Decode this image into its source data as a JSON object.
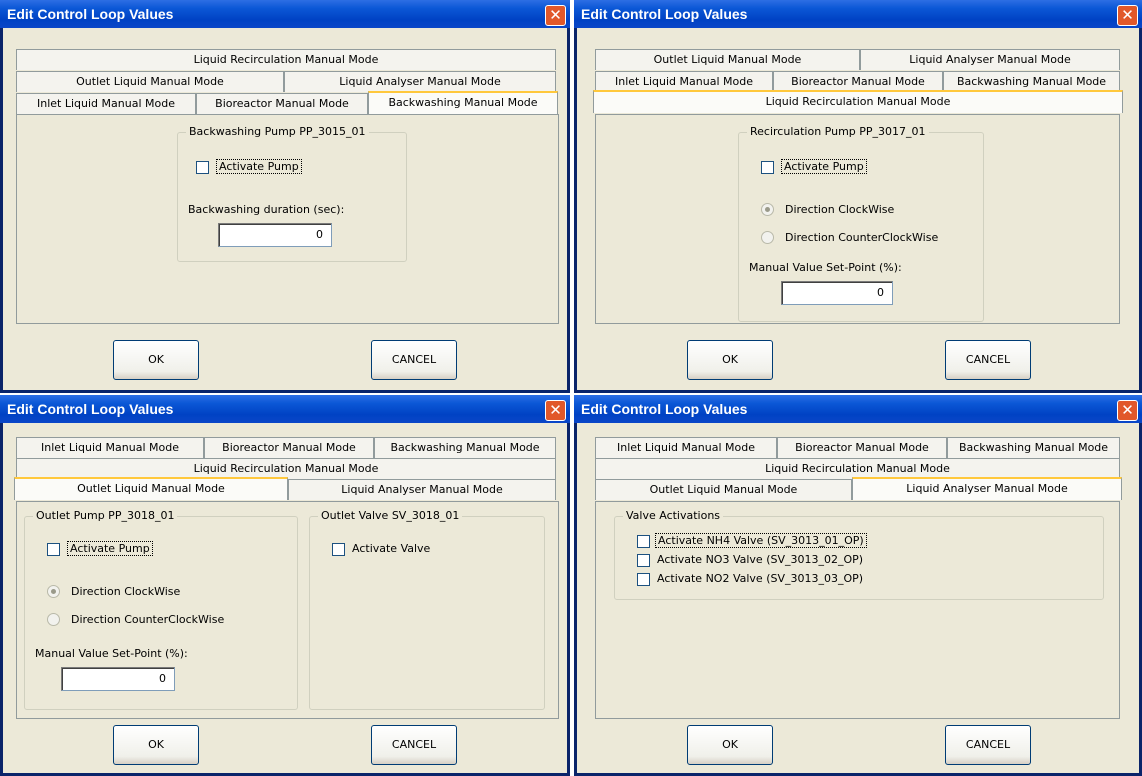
{
  "common": {
    "title": "Edit Control Loop Values",
    "close_glyph": "✕",
    "ok_label": "OK",
    "cancel_label": "CANCEL",
    "tabs": {
      "inlet": "Inlet Liquid Manual Mode",
      "bioreactor": "Bioreactor Manual Mode",
      "backwashing": "Backwashing Manual Mode",
      "recirculation": "Liquid Recirculation Manual Mode",
      "outlet": "Outlet Liquid Manual Mode",
      "analyser": "Liquid Analyser Manual Mode"
    }
  },
  "dialog_backwashing": {
    "active_tab": "Backwashing Manual Mode",
    "group_title": "Backwashing Pump PP_3015_01",
    "activate_pump_label": "Activate Pump",
    "activate_pump_checked": false,
    "duration_label": "Backwashing duration (sec):",
    "duration_value": "0"
  },
  "dialog_recirculation": {
    "active_tab": "Liquid Recirculation Manual Mode",
    "group_title": "Recirculation Pump PP_3017_01",
    "activate_pump_label": "Activate Pump",
    "activate_pump_checked": false,
    "direction_cw_label": "Direction ClockWise",
    "direction_cw_selected": true,
    "direction_ccw_label": "Direction CounterClockWise",
    "setpoint_label": "Manual Value Set-Point (%):",
    "setpoint_value": "0"
  },
  "dialog_outlet": {
    "active_tab": "Outlet Liquid Manual Mode",
    "pump_group_title": "Outlet Pump PP_3018_01",
    "activate_pump_label": "Activate Pump",
    "direction_cw_label": "Direction ClockWise",
    "direction_ccw_label": "Direction CounterClockWise",
    "setpoint_label": "Manual Value Set-Point (%):",
    "setpoint_value": "0",
    "valve_group_title": "Outlet Valve SV_3018_01",
    "activate_valve_label": "Activate Valve"
  },
  "dialog_analyser": {
    "active_tab": "Liquid Analyser Manual Mode",
    "group_title": "Valve Activations",
    "valves": [
      {
        "label": "Activate NH4 Valve (SV_3013_01_OP)",
        "checked": false
      },
      {
        "label": "Activate NO3 Valve (SV_3013_02_OP)",
        "checked": false
      },
      {
        "label": "Activate NO2 Valve (SV_3013_03_OP)",
        "checked": false
      }
    ]
  }
}
